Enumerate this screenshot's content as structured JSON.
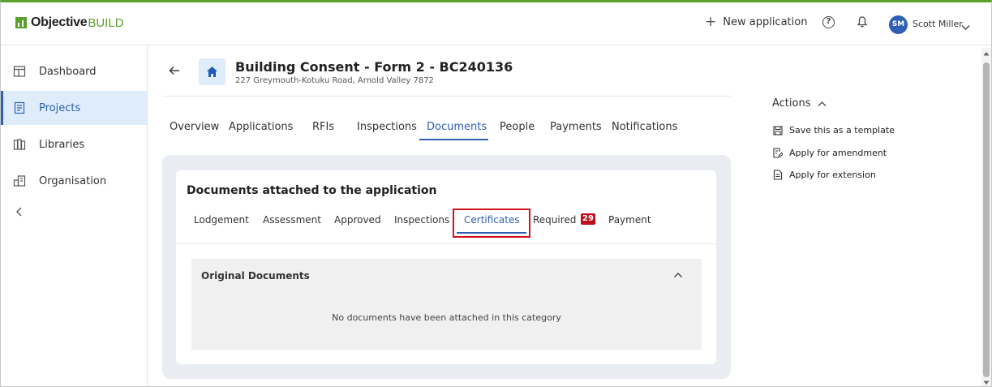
{
  "brand": {
    "name_bold": "Objective",
    "name_light": "BUILD",
    "accent": "#5aa02c"
  },
  "header": {
    "new_application_label": "New application",
    "help_icon": "help-circle-icon",
    "notifications_icon": "bell-icon",
    "user_initials": "SM",
    "user_name": "Scott Miller"
  },
  "sidebar": {
    "items": [
      {
        "label": "Dashboard",
        "icon": "dashboard-icon"
      },
      {
        "label": "Projects",
        "icon": "projects-icon",
        "active": true
      },
      {
        "label": "Libraries",
        "icon": "libraries-icon"
      },
      {
        "label": "Organisation",
        "icon": "organisation-icon"
      }
    ],
    "collapse_icon": "chevron-left-icon"
  },
  "page": {
    "title": "Building Consent - Form 2 - BC240136",
    "address": "227 Greymouth-Kotuku Road, Arnold Valley 7872"
  },
  "tabs": [
    {
      "label": "Overview"
    },
    {
      "label": "Applications"
    },
    {
      "label": "RFIs"
    },
    {
      "label": "Inspections"
    },
    {
      "label": "Documents",
      "active": true
    },
    {
      "label": "People"
    },
    {
      "label": "Payments"
    },
    {
      "label": "Notifications"
    }
  ],
  "documents": {
    "title": "Documents attached to the application",
    "subtabs": [
      {
        "label": "Lodgement"
      },
      {
        "label": "Assessment"
      },
      {
        "label": "Approved"
      },
      {
        "label": "Inspections"
      },
      {
        "label": "Certificates",
        "active": true
      },
      {
        "label": "Required",
        "badge": "29"
      },
      {
        "label": "Payment"
      }
    ],
    "section_title": "Original Documents",
    "empty_message": "No documents have been attached in this category"
  },
  "actions": {
    "heading": "Actions",
    "items": [
      {
        "label": "Save this as a template",
        "icon": "save-icon"
      },
      {
        "label": "Apply for amendment",
        "icon": "edit-document-icon"
      },
      {
        "label": "Apply for extension",
        "icon": "document-icon"
      }
    ]
  },
  "colors": {
    "primary": "#2e5fb4",
    "highlight": "#d0141c",
    "badge": "#c00d1b"
  }
}
